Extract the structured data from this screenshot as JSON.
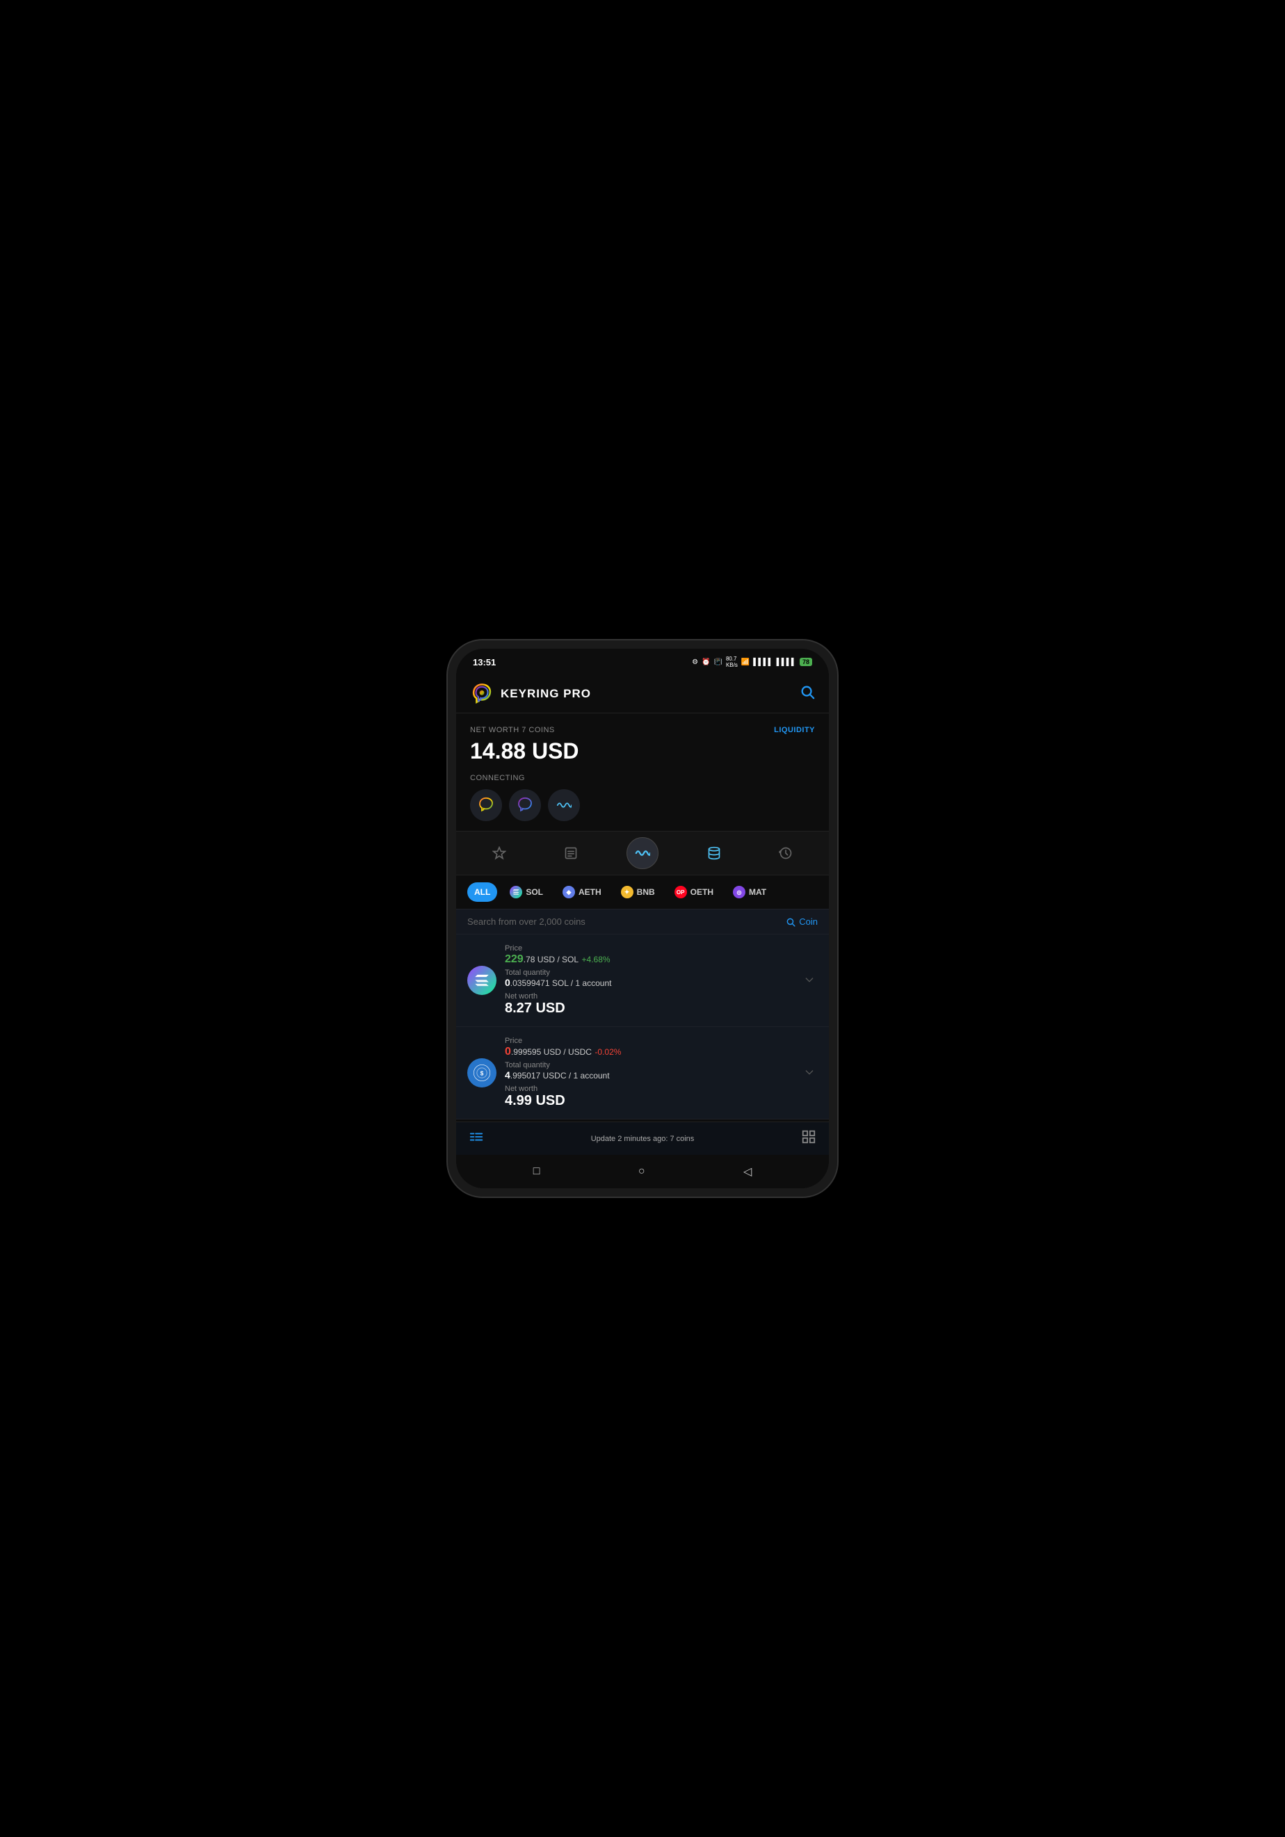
{
  "status_bar": {
    "time": "13:51",
    "battery": "78"
  },
  "header": {
    "app_name": "KEYRING PRO",
    "search_label": "search"
  },
  "net_worth": {
    "label": "NET WORTH 7 COINS",
    "value": "14.88 USD",
    "liquidity_label": "LIQUIDITY",
    "connecting_label": "CONNECTING"
  },
  "nav_tabs": [
    {
      "id": "pin",
      "label": "pin"
    },
    {
      "id": "list",
      "label": "list"
    },
    {
      "id": "wave",
      "label": "wave",
      "active": true
    },
    {
      "id": "database",
      "label": "database"
    },
    {
      "id": "history",
      "label": "history"
    }
  ],
  "chain_filters": [
    {
      "id": "all",
      "label": "ALL",
      "active": true
    },
    {
      "id": "sol",
      "label": "SOL"
    },
    {
      "id": "aeth",
      "label": "AETH"
    },
    {
      "id": "bnb",
      "label": "BNB"
    },
    {
      "id": "oeth",
      "label": "OETH"
    },
    {
      "id": "mat",
      "label": "MAT"
    }
  ],
  "search_bar": {
    "placeholder": "Search from over 2,000 coins",
    "action_label": "Coin"
  },
  "coins": [
    {
      "id": "sol",
      "price_label": "Price",
      "price_main": "229",
      "price_decimals": ".78 USD / SOL",
      "price_change": "+4.68%",
      "price_change_positive": true,
      "qty_label": "Total quantity",
      "qty_main": "0",
      "qty_decimals": ".03599471 SOL / 1 account",
      "net_worth_label": "Net worth",
      "net_worth_value": "8.27 USD"
    },
    {
      "id": "usdc",
      "price_label": "Price",
      "price_main": "0",
      "price_decimals": ".999595 USD / USDC",
      "price_change": "-0.02%",
      "price_change_positive": false,
      "qty_label": "Total quantity",
      "qty_main": "4",
      "qty_decimals": ".995017 USDC / 1 account",
      "net_worth_label": "Net worth",
      "net_worth_value": "4.99 USD"
    }
  ],
  "bottom_bar": {
    "update_text": "Update 2 minutes ago: 7 coins"
  },
  "android_nav": {
    "back": "◁",
    "home": "○",
    "recent": "□"
  }
}
